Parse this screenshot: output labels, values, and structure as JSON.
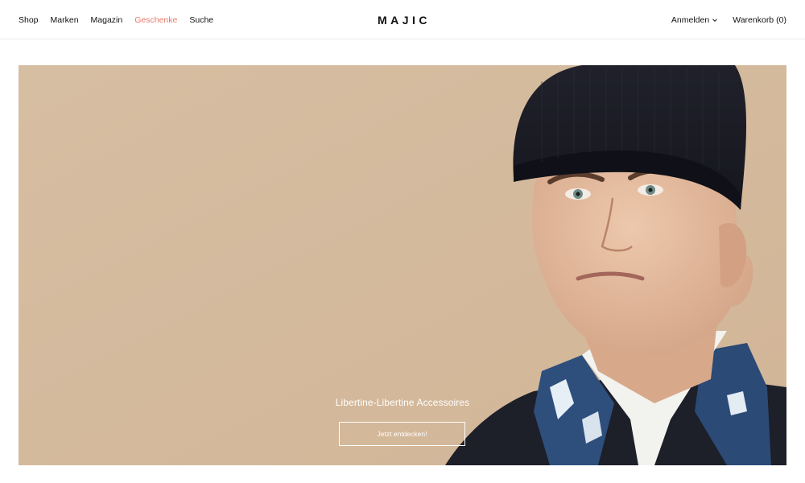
{
  "header": {
    "nav": [
      {
        "label": "Shop"
      },
      {
        "label": "Marken"
      },
      {
        "label": "Magazin"
      },
      {
        "label": "Geschenke",
        "active": true
      },
      {
        "label": "Suche"
      }
    ],
    "logo": "MAJIC",
    "login_label": "Anmelden",
    "cart_label": "Warenkorb",
    "cart_count": "(0)"
  },
  "hero": {
    "caption": "Libertine-Libertine Accessoires",
    "cta_label": "Jetzt entdecken!"
  },
  "colors": {
    "accent": "#e9796b",
    "hero_background": "#d8bfa3",
    "text": "#111111"
  },
  "icons": {
    "login_dropdown": "chevron-down-icon"
  }
}
